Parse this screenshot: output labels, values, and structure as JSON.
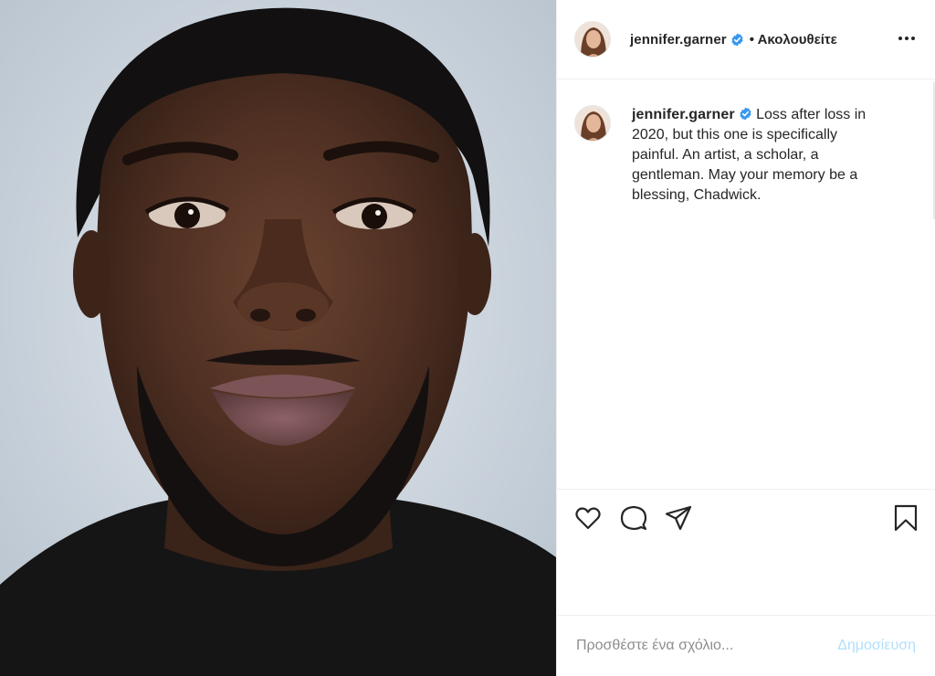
{
  "post": {
    "username": "jennifer.garner",
    "follow_status": "• Ακολουθείτε",
    "caption": "Loss after loss in 2020, but this one is specifically painful. An artist, a scholar, a gentleman. May your memory be a blessing, Chadwick."
  },
  "actions": {
    "icons": [
      "heart-icon",
      "comment-icon",
      "share-icon",
      "bookmark-icon"
    ]
  },
  "comment": {
    "placeholder": "Προσθέστε ένα σχόλιο...",
    "post_label": "Δημοσίευση"
  },
  "colors": {
    "verified": "#3897f0",
    "post_button_disabled": "#b2dffc",
    "border": "#efefef"
  }
}
